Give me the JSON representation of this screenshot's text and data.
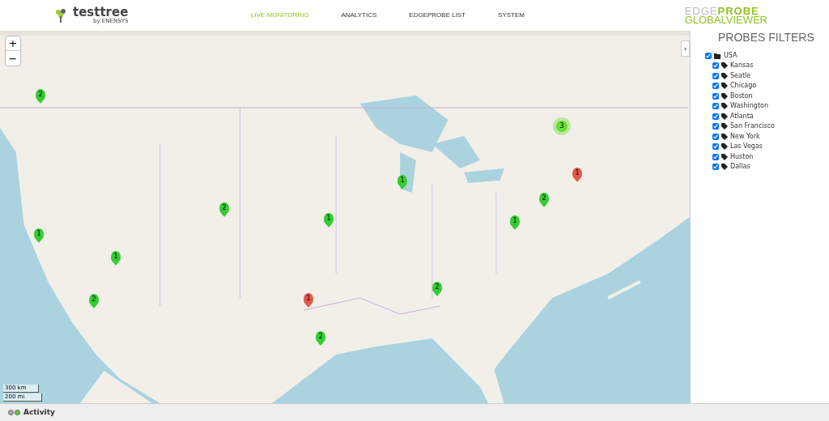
{
  "header": {
    "logo": {
      "name": "testtree",
      "byline": "by ENENSYS"
    },
    "nav": [
      {
        "label": "LIVE MONITORING",
        "selected": true
      },
      {
        "label": "ANALYTICS",
        "selected": false
      },
      {
        "label": "EDGEPROBE LIST",
        "selected": false
      },
      {
        "label": "SYSTEM",
        "selected": false
      }
    ],
    "brand": {
      "top_light": "EDGE",
      "top_bold": "PROBE",
      "bottom": "GLOBALVIEWER"
    }
  },
  "map": {
    "kind": "picture",
    "zoom_in": "+",
    "zoom_out": "−",
    "scale": [
      "300 km",
      "200 mi"
    ],
    "markers": [
      {
        "count": "2",
        "color": "#33cc33"
      },
      {
        "count": "1",
        "color": "#33cc33"
      },
      {
        "count": "1",
        "color": "#33cc33"
      },
      {
        "count": "2",
        "color": "#33cc33"
      },
      {
        "count": "2",
        "color": "#33cc33"
      },
      {
        "count": "1",
        "color": "#33cc33"
      },
      {
        "count": "1",
        "color": "#33cc33"
      },
      {
        "count": "1",
        "color": "#e05a4a"
      },
      {
        "count": "2",
        "color": "#33cc33"
      },
      {
        "count": "2",
        "color": "#33cc33"
      },
      {
        "count": "1",
        "color": "#33cc33"
      },
      {
        "count": "2",
        "color": "#33cc33"
      },
      {
        "count": "1",
        "color": "#e05a4a"
      }
    ],
    "cluster": {
      "count": "3",
      "color": "#66dd33"
    },
    "collapse": "›"
  },
  "filters": {
    "title": "PROBES FILTERS",
    "root": {
      "label": "USA",
      "checked": true,
      "children": [
        {
          "label": "Kansas",
          "checked": true
        },
        {
          "label": "Seatle",
          "checked": true
        },
        {
          "label": "Chicago",
          "checked": true
        },
        {
          "label": "Boston",
          "checked": true
        },
        {
          "label": "Washington",
          "checked": true
        },
        {
          "label": "Atlanta",
          "checked": true
        },
        {
          "label": "San Francisco",
          "checked": true
        },
        {
          "label": "New York",
          "checked": true
        },
        {
          "label": "Las Vegas",
          "checked": true
        },
        {
          "label": "Huston",
          "checked": true
        },
        {
          "label": "Dallas",
          "checked": true
        }
      ]
    }
  },
  "status_bar": {
    "label": "Activity",
    "lights": [
      {
        "on": false
      },
      {
        "on": true
      }
    ]
  }
}
